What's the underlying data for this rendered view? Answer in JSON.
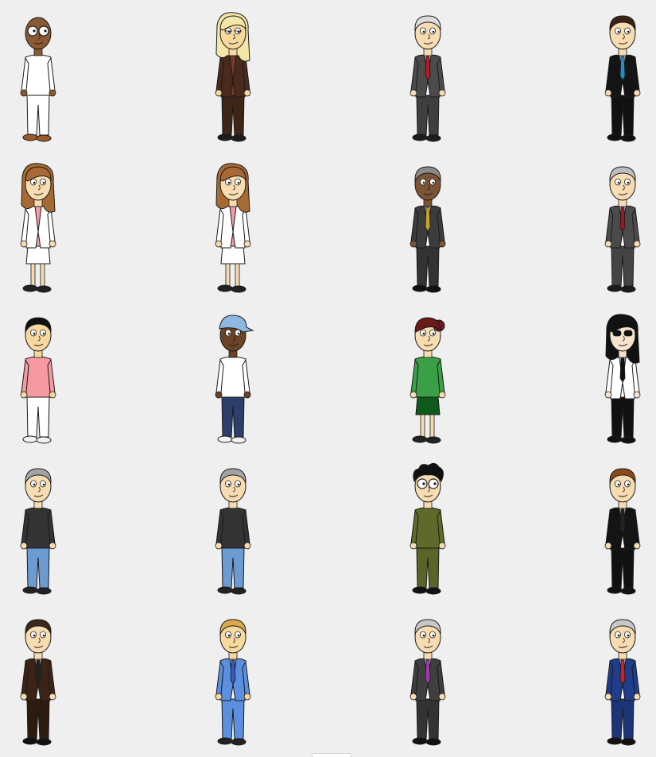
{
  "characters": [
    {
      "name": "character-bald-man-white-outfit",
      "skin": "#8a5a33",
      "hair": "none",
      "hairColor": "#000000",
      "top": "shirt",
      "topColor": "#ffffff",
      "shirt": "#ffffff",
      "tie": "none",
      "bottom": "pants",
      "bottomColor": "#ffffff",
      "shoes": "#9a5a28",
      "glasses": "big"
    },
    {
      "name": "character-blonde-woman-brown-suit",
      "skin": "#f7d9a0",
      "hair": "long",
      "hairColor": "#f3e6a6",
      "top": "jacket",
      "topColor": "#4a2a1c",
      "shirt": "#7a3a2a",
      "tie": "none",
      "bottom": "pants",
      "bottomColor": "#3d2617",
      "shoes": "#1c1c1c",
      "glasses": "small"
    },
    {
      "name": "character-old-man-gray-suit-red-tie",
      "skin": "#f6dcb0",
      "hair": "short",
      "hairColor": "#dddddd",
      "top": "jacket",
      "topColor": "#4b4b4b",
      "shirt": "#ffffff",
      "tie": "#b51b22",
      "bottom": "pants",
      "bottomColor": "#3f3f3f",
      "shoes": "#1c1c1c",
      "glasses": "none"
    },
    {
      "name": "character-man-black-suit-blue-tie",
      "skin": "#f6dcb0",
      "hair": "short",
      "hairColor": "#3b2414",
      "top": "jacket",
      "topColor": "#141414",
      "shirt": "#ffffff",
      "tie": "#1f8fc7",
      "bottom": "pants",
      "bottomColor": "#111111",
      "shoes": "#111111",
      "glasses": "none"
    },
    {
      "name": "character-woman-pink-top-white-skirt",
      "skin": "#f6dcb0",
      "hair": "long",
      "hairColor": "#a86a35",
      "top": "jacket",
      "topColor": "#ffffff",
      "shirt": "#f49ca7",
      "tie": "none",
      "bottom": "skirt",
      "bottomColor": "#ffffff",
      "shoes": "#222222",
      "glasses": "none"
    },
    {
      "name": "character-woman-pink-top-white-skirt-2",
      "skin": "#f6dcb0",
      "hair": "long",
      "hairColor": "#a86a35",
      "top": "jacket",
      "topColor": "#ffffff",
      "shirt": "#f49ca7",
      "tie": "none",
      "bottom": "skirt",
      "bottomColor": "#ffffff",
      "shoes": "#222222",
      "glasses": "none"
    },
    {
      "name": "character-man-mustache-gray-suit-gold-tie",
      "skin": "#7a5434",
      "hair": "short",
      "hairColor": "#8a8a8a",
      "top": "jacket",
      "topColor": "#3c3c3c",
      "shirt": "#ffffff",
      "tie": "#c9a22a",
      "bottom": "pants",
      "bottomColor": "#333333",
      "shoes": "#111111",
      "glasses": "none"
    },
    {
      "name": "character-gray-hair-man-gray-suit-red-tie",
      "skin": "#f6dcb0",
      "hair": "short",
      "hairColor": "#bdbdbd",
      "top": "jacket",
      "topColor": "#4b4b4b",
      "shirt": "#ffffff",
      "tie": "#a01820",
      "bottom": "pants",
      "bottomColor": "#444444",
      "shoes": "#1c1c1c",
      "glasses": "none"
    },
    {
      "name": "character-man-pink-shirt-white-pants",
      "skin": "#f7d9a0",
      "hair": "short",
      "hairColor": "#111111",
      "top": "shirt",
      "topColor": "#f49aa0",
      "shirt": "#f49aa0",
      "tie": "none",
      "bottom": "pants",
      "bottomColor": "#ffffff",
      "shoes": "#f2f2f2",
      "glasses": "none"
    },
    {
      "name": "character-rapper-blue-cap-gold-chain",
      "skin": "#6b4226",
      "hair": "cap",
      "hairColor": "#8fb7df",
      "top": "shirt",
      "topColor": "#ffffff",
      "shirt": "#ffffff",
      "tie": "none",
      "bottom": "pants",
      "bottomColor": "#2d3e6b",
      "shoes": "#f2f2f2",
      "glasses": "none"
    },
    {
      "name": "character-woman-green-top-green-skirt",
      "skin": "#f6dcb0",
      "hair": "bun",
      "hairColor": "#6b1a1a",
      "top": "shirt",
      "topColor": "#3aa046",
      "shirt": "#3aa046",
      "tie": "none",
      "bottom": "skirt",
      "bottomColor": "#0f5a1a",
      "shoes": "#222222",
      "glasses": "none"
    },
    {
      "name": "character-sunglasses-white-jacket",
      "skin": "#f7e3cc",
      "hair": "long",
      "hairColor": "#111111",
      "top": "jacket",
      "topColor": "#ffffff",
      "shirt": "#ffffff",
      "tie": "#111111",
      "bottom": "pants",
      "bottomColor": "#111111",
      "shoes": "#111111",
      "glasses": "sunglasses"
    },
    {
      "name": "character-old-man-black-shirt-jeans",
      "skin": "#f6dcb0",
      "hair": "short",
      "hairColor": "#a3a3a3",
      "top": "shirt",
      "topColor": "#333333",
      "shirt": "#333333",
      "tie": "none",
      "bottom": "pants",
      "bottomColor": "#6b9bd1",
      "shoes": "#222222",
      "glasses": "none"
    },
    {
      "name": "character-old-man-black-shirt-jeans-2",
      "skin": "#f6dcb0",
      "hair": "short",
      "hairColor": "#a3a3a3",
      "top": "shirt",
      "topColor": "#333333",
      "shirt": "#333333",
      "tie": "none",
      "bottom": "pants",
      "bottomColor": "#6b9bd1",
      "shoes": "#222222",
      "glasses": "none"
    },
    {
      "name": "character-curly-hair-glasses-olive-uniform",
      "skin": "#f6dcb0",
      "hair": "curly",
      "hairColor": "#111111",
      "top": "shirt",
      "topColor": "#5f6a2a",
      "shirt": "#5f6a2a",
      "tie": "none",
      "bottom": "pants",
      "bottomColor": "#5a6328",
      "shoes": "#111111",
      "glasses": "big"
    },
    {
      "name": "character-man-black-suit-black-tie",
      "skin": "#f6dcb0",
      "hair": "short",
      "hairColor": "#8a4a1c",
      "top": "jacket",
      "topColor": "#141414",
      "shirt": "#ffffff",
      "tie": "#222222",
      "bottom": "pants",
      "bottomColor": "#111111",
      "shoes": "#111111",
      "glasses": "none"
    },
    {
      "name": "character-bearded-man-brown-suit",
      "skin": "#f6dcb0",
      "hair": "short",
      "hairColor": "#3a2a1a",
      "top": "jacket",
      "topColor": "#3b2416",
      "shirt": "#ffffff",
      "tie": "#222222",
      "bottom": "pants",
      "bottomColor": "#2e1b10",
      "shoes": "#111111",
      "glasses": "none"
    },
    {
      "name": "character-blond-man-light-blue-suit",
      "skin": "#f7d9a0",
      "hair": "short",
      "hairColor": "#d8a84a",
      "top": "jacket",
      "topColor": "#5b8fe0",
      "shirt": "#ffffff",
      "tie": "#3a5ab8",
      "bottom": "pants",
      "bottomColor": "#5b8fe0",
      "shoes": "#222222",
      "glasses": "none"
    },
    {
      "name": "character-gray-hair-man-purple-tie",
      "skin": "#f6dcb0",
      "hair": "short",
      "hairColor": "#c7c7c7",
      "top": "jacket",
      "topColor": "#3f3f3f",
      "shirt": "#ffffff",
      "tie": "#a13aa8",
      "bottom": "pants",
      "bottomColor": "#333333",
      "shoes": "#111111",
      "glasses": "none"
    },
    {
      "name": "character-gray-hair-man-navy-suit-red-tie",
      "skin": "#f6dcb0",
      "hair": "short",
      "hairColor": "#c7c7c7",
      "top": "jacket",
      "topColor": "#1f3d8a",
      "shirt": "#ffffff",
      "tie": "#c42230",
      "bottom": "pants",
      "bottomColor": "#1b3578",
      "shoes": "#111111",
      "glasses": "none"
    }
  ]
}
